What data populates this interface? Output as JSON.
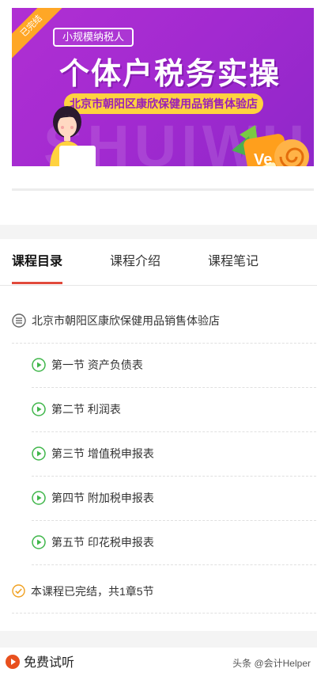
{
  "banner": {
    "ribbon": "已完结",
    "tag": "小规模纳税人",
    "title": "个体户税务实操",
    "store": "北京市朝阳区康欣保健用品销售体验店",
    "bg_text": "SHUIWU",
    "logo_text": "Ve"
  },
  "tabs": [
    {
      "label": "课程目录",
      "active": true
    },
    {
      "label": "课程介绍",
      "active": false
    },
    {
      "label": "课程笔记",
      "active": false
    }
  ],
  "catalog": {
    "chapter": "北京市朝阳区康欣保健用品销售体验店",
    "lessons": [
      {
        "label": "第一节 资产负债表"
      },
      {
        "label": "第二节 利润表"
      },
      {
        "label": "第三节 增值税申报表"
      },
      {
        "label": "第四节 附加税申报表"
      },
      {
        "label": "第五节 印花税申报表"
      }
    ],
    "status": "本课程已完结，共1章5节"
  },
  "footer": {
    "trial_label": "免费试听",
    "watermark": "头条 @会计Helper"
  },
  "colors": {
    "accent": "#e14a3b",
    "play_green": "#3fb64a",
    "check_orange": "#f0a020",
    "banner_purple": "#a22ad0",
    "store_yellow": "#ffd23f"
  }
}
